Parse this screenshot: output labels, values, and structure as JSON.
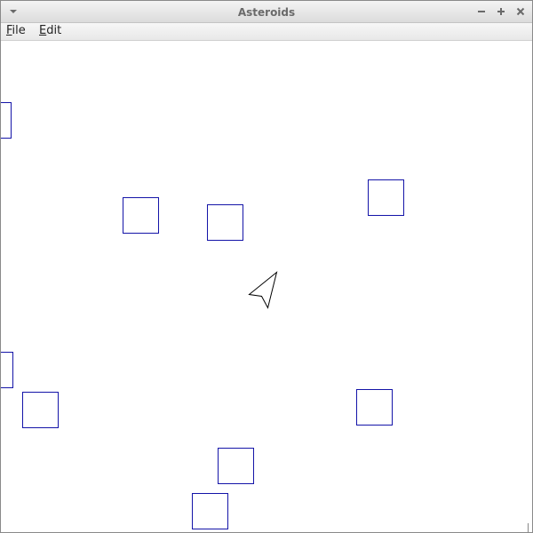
{
  "window": {
    "title": "Asteroids",
    "window_menu_icon": "chevron-down-icon",
    "controls": {
      "minimize_icon": "minimize-icon",
      "maximize_icon": "maximize-icon",
      "close_icon": "close-icon"
    }
  },
  "menubar": {
    "items": [
      {
        "label": "File"
      },
      {
        "label": "Edit"
      }
    ]
  },
  "game": {
    "colors": {
      "background": "#ffffff",
      "asteroid_stroke": "#1414a8",
      "ship_stroke": "#000000"
    },
    "asteroid_count": 9,
    "ship": {
      "icon": "spaceship-arrow-icon"
    }
  }
}
